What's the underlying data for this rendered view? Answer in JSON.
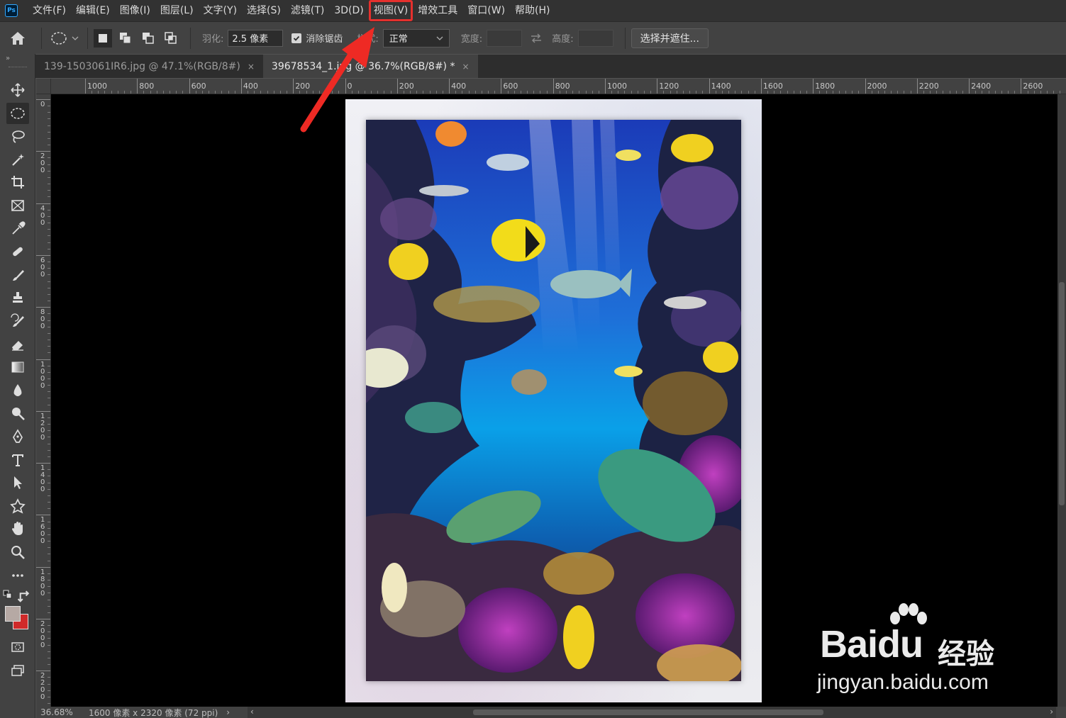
{
  "app": {
    "logo": "Ps"
  },
  "menu": {
    "items": [
      "文件(F)",
      "编辑(E)",
      "图像(I)",
      "图层(L)",
      "文字(Y)",
      "选择(S)",
      "滤镜(T)",
      "3D(D)",
      "视图(V)",
      "增效工具",
      "窗口(W)",
      "帮助(H)"
    ],
    "highlighted": "视图(V)"
  },
  "options": {
    "feather_label": "羽化:",
    "feather_value": "2.5 像素",
    "antialias_label": "消除锯齿",
    "antialias_checked": true,
    "style_label": "样式:",
    "style_value": "正常",
    "width_label": "宽度:",
    "height_label": "高度:",
    "select_mask_button": "选择并遮住..."
  },
  "tabs": [
    {
      "title": "139-1503061IR6.jpg @ 47.1%(RGB/8#)",
      "close": "×",
      "active": false
    },
    {
      "title": "39678534_1.jpg @ 36.7%(RGB/8#) *",
      "close": "×",
      "active": true
    }
  ],
  "rulers": {
    "horizontal": [
      "1000",
      "800",
      "600",
      "400",
      "200",
      "0",
      "200",
      "400",
      "600",
      "800",
      "1000",
      "1200",
      "1400",
      "1600",
      "1800",
      "2000",
      "2200",
      "2400",
      "2600"
    ],
    "vertical": [
      "0",
      "200",
      "400",
      "600",
      "800",
      "1000",
      "1200",
      "1400",
      "1600",
      "1800",
      "2000",
      "2200"
    ]
  },
  "tools": [
    "move-tool",
    "elliptical-marquee-tool",
    "lasso-tool",
    "magic-wand-tool",
    "crop-tool",
    "frame-tool",
    "eyedropper-tool",
    "healing-brush-tool",
    "brush-tool",
    "clone-stamp-tool",
    "history-brush-tool",
    "eraser-tool",
    "gradient-tool",
    "blur-tool",
    "dodge-tool",
    "pen-tool",
    "type-tool",
    "path-selection-tool",
    "shape-tool",
    "hand-tool",
    "zoom-tool",
    "more-tools"
  ],
  "colors": {
    "foreground": "#b6a9a4",
    "background": "#d02a2a",
    "highlight": "#e5302d"
  },
  "status": {
    "zoom": "36.68%",
    "doc_size": "1600 像素 x 2320 像素 (72 ppi)",
    "arrow": "›",
    "scroll_left": "‹",
    "scroll_right": "›"
  },
  "watermark": {
    "brand": "Bai",
    "brand_du": "du",
    "cn": "经验",
    "url": "jingyan.baidu.com"
  }
}
